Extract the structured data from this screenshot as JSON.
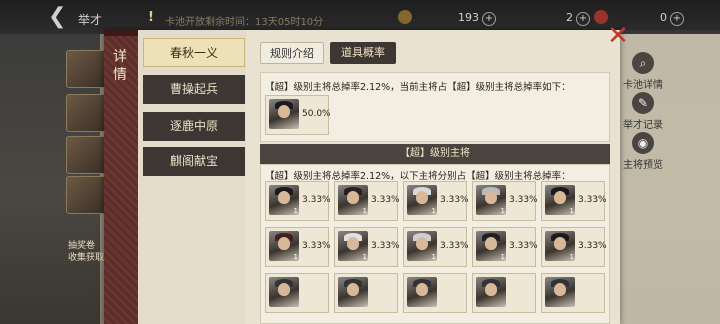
{
  "topbar": {
    "title": "举才",
    "warning": "!",
    "message": "卡池开放剩余时间：13天05时10分",
    "resource1": "193",
    "resource2": "2",
    "resource3": "0"
  },
  "background": {
    "bottom_note": "抽奖卷\n收集获取",
    "side_items": [
      "卡池详情",
      "举才记录",
      "主将预览"
    ]
  },
  "dialog": {
    "detail_label": "详情",
    "nav": [
      "春秋一义",
      "曹操起兵",
      "逐鹿中原",
      "麒阁献宝"
    ],
    "tabs": [
      "规则介绍",
      "道具概率"
    ],
    "section1": {
      "text": "【超】级别主将总掉率2.12%，当前主将占【超】级别主将总掉率如下：",
      "card": {
        "pct": "50.0%"
      }
    },
    "section2": {
      "header": "【超】级别主将",
      "text": "【超】级别主将总掉率2.12%，以下主将分别占【超】级别主将总掉率：",
      "cards": [
        {
          "pct": "3.33%",
          "badge": "1"
        },
        {
          "pct": "3.33%",
          "badge": "1"
        },
        {
          "pct": "3.33%",
          "badge": "1"
        },
        {
          "pct": "3.33%",
          "badge": "1"
        },
        {
          "pct": "3.33%",
          "badge": "1"
        },
        {
          "pct": "3.33%",
          "badge": "1"
        },
        {
          "pct": "3.33%",
          "badge": "1"
        },
        {
          "pct": "3.33%",
          "badge": "1"
        },
        {
          "pct": "3.33%",
          "badge": "1"
        },
        {
          "pct": "3.33%",
          "badge": "1"
        },
        {
          "pct": "",
          "badge": ""
        },
        {
          "pct": "",
          "badge": ""
        },
        {
          "pct": "",
          "badge": ""
        },
        {
          "pct": "",
          "badge": ""
        },
        {
          "pct": "",
          "badge": ""
        }
      ]
    }
  },
  "icons": {
    "back": "arrow-left-icon",
    "close": "close-icon",
    "side": [
      "magnifier-icon",
      "feather-icon",
      "eye-icon"
    ]
  }
}
